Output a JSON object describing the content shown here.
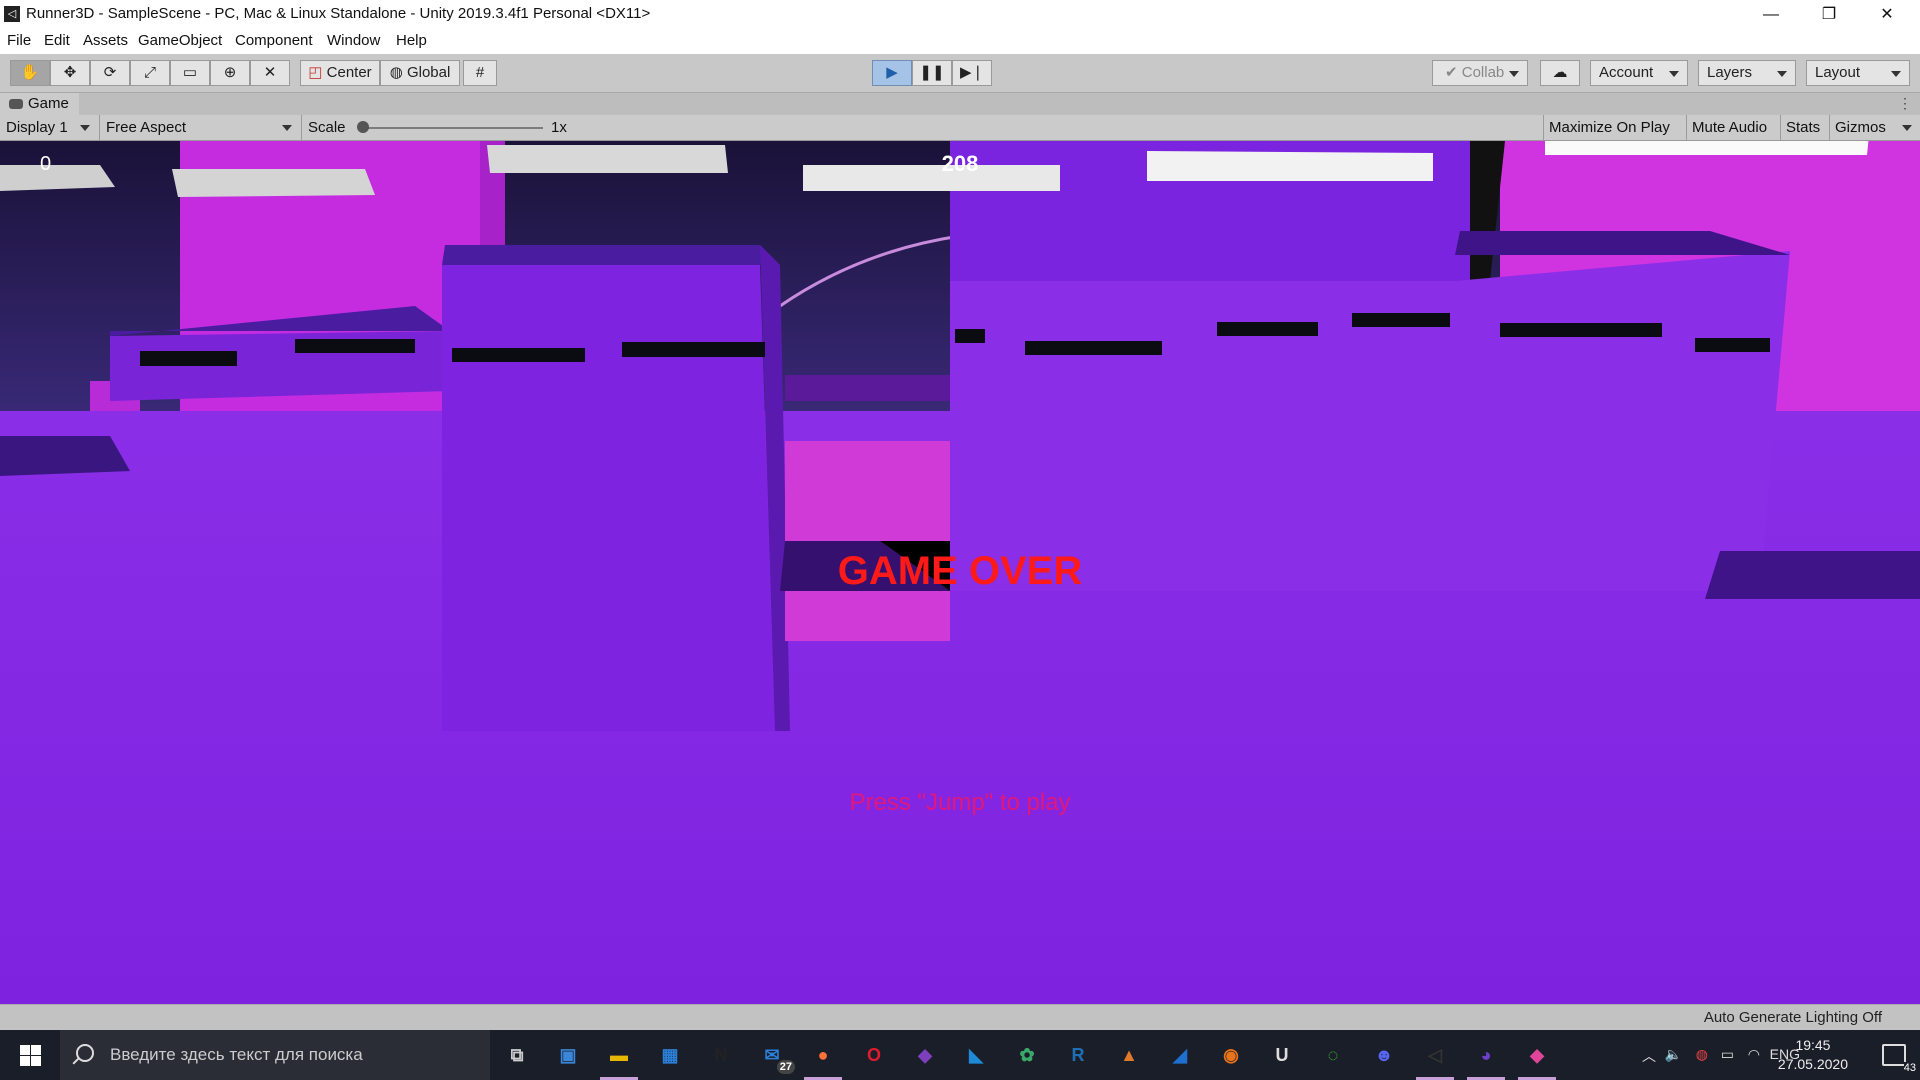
{
  "window": {
    "title": "Runner3D - SampleScene - PC, Mac & Linux Standalone - Unity 2019.3.4f1 Personal <DX11>",
    "minimize_icon": "minimize-icon",
    "maximize_icon": "restore-icon",
    "close_icon": "close-icon"
  },
  "menu": [
    "File",
    "Edit",
    "Assets",
    "GameObject",
    "Component",
    "Window",
    "Help"
  ],
  "toolbar": {
    "tools": [
      "hand-icon",
      "move-icon",
      "rotate-icon",
      "scale-icon",
      "rect-icon",
      "transform-icon",
      "custom-tool-icon"
    ],
    "pivot_label": "Center",
    "space_label": "Global",
    "grid_snap_icon": "grid-snap-icon",
    "play_icon": "play-icon",
    "pause_icon": "pause-icon",
    "step_icon": "step-icon",
    "collab_label": "Collab",
    "cloud_icon": "cloud-icon",
    "account_label": "Account",
    "layers_label": "Layers",
    "layout_label": "Layout",
    "play_active": true
  },
  "game_tab": {
    "label": "Game",
    "more_icon": "kebab-menu-icon"
  },
  "game_options": {
    "display": "Display 1",
    "aspect": "Free Aspect",
    "scale_label": "Scale",
    "scale_value": "1x",
    "scale_level": 0,
    "maximize_on_play": "Maximize On Play",
    "mute_audio": "Mute Audio",
    "stats": "Stats",
    "gizmos": "Gizmos"
  },
  "hud": {
    "score_left": "0",
    "score_center": "208",
    "game_over": "GAME OVER",
    "press_to_play": "Press \"Jump\" to play"
  },
  "status_bar": {
    "text": "Auto Generate Lighting Off"
  },
  "taskbar": {
    "search_placeholder": "Введите здесь текст для поиска",
    "apps": [
      {
        "name": "task-view-icon",
        "glyph": "⧉"
      },
      {
        "name": "contacts-app-icon",
        "glyph": "▣"
      },
      {
        "name": "file-explorer-icon",
        "glyph": "▬"
      },
      {
        "name": "store-icon",
        "glyph": "▦"
      },
      {
        "name": "notion-icon",
        "glyph": "N"
      },
      {
        "name": "mail-icon",
        "glyph": "✉",
        "badge": "27"
      },
      {
        "name": "firefox-icon",
        "glyph": "●"
      },
      {
        "name": "opera-icon",
        "glyph": "O"
      },
      {
        "name": "visual-studio-icon",
        "glyph": "◆"
      },
      {
        "name": "vscode-icon",
        "glyph": "◣"
      },
      {
        "name": "chrome-like-icon",
        "glyph": "✿"
      },
      {
        "name": "rider-icon",
        "glyph": "R"
      },
      {
        "name": "matlab-icon",
        "glyph": "▲"
      },
      {
        "name": "shark-app-icon",
        "glyph": "◢"
      },
      {
        "name": "blender-icon",
        "glyph": "◉"
      },
      {
        "name": "unreal-icon",
        "glyph": "U"
      },
      {
        "name": "razer-icon",
        "glyph": "◌"
      },
      {
        "name": "discord-icon",
        "glyph": "☻"
      },
      {
        "name": "unity-icon",
        "glyph": "◁"
      },
      {
        "name": "github-icon",
        "glyph": "◕"
      },
      {
        "name": "paint-drop-icon",
        "glyph": "◆"
      }
    ],
    "tray": {
      "language": "ENG",
      "time": "19:45",
      "date": "27.05.2020",
      "notifications": "43"
    }
  }
}
